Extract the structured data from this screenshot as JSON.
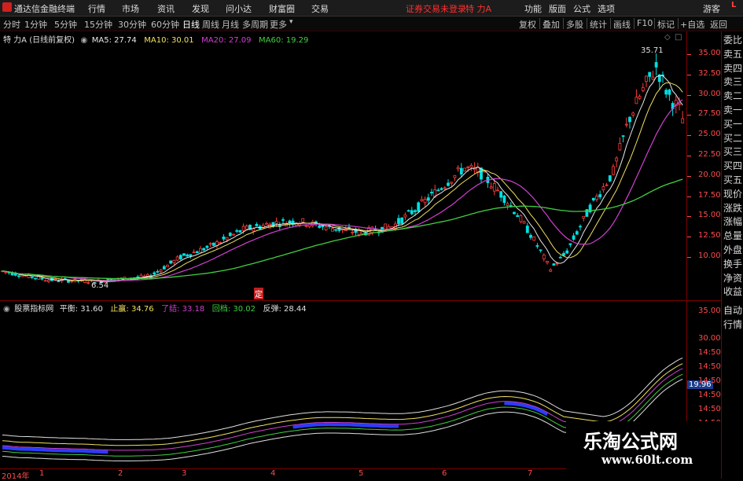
{
  "menubar": {
    "app_title": "通达信金融终端",
    "items": [
      "行情",
      "市场",
      "资讯",
      "发现",
      "问小达",
      "财富圈",
      "交易"
    ],
    "notice": "证券交易未登录",
    "stock_name": "特 力A",
    "right_items": [
      "功能",
      "版面",
      "公式",
      "选项"
    ],
    "user": "游客",
    "corner": "L"
  },
  "periodbar": {
    "periods": [
      "分时",
      "1分钟",
      "5分钟",
      "15分钟",
      "30分钟",
      "60分钟",
      "日线",
      "周线",
      "月线",
      "多周期",
      "更多"
    ],
    "active": "日线",
    "tools": [
      "复权",
      "叠加",
      "多股",
      "统计",
      "画线",
      "F10",
      "标记",
      "+自选",
      "返回"
    ]
  },
  "main": {
    "title": "特 力A (日线前复权)",
    "ma": [
      {
        "label": "MA5: 27.74",
        "color": "#e8e8e8"
      },
      {
        "label": "MA10: 30.01",
        "color": "#f0e060"
      },
      {
        "label": "MA20: 27.09",
        "color": "#d040d0"
      },
      {
        "label": "MA60: 19.29",
        "color": "#40d040"
      }
    ],
    "high_label": "35.71",
    "low_label": "6.54",
    "marker": "定",
    "price_ticks": [
      "35.00",
      "32.50",
      "30.00",
      "27.50",
      "25.00",
      "22.50",
      "20.00",
      "17.50",
      "15.00",
      "12.50",
      "10.00"
    ]
  },
  "indicator": {
    "name": "股票指标网",
    "items": [
      {
        "label": "平衡: 31.60",
        "color": "#e0e0e0"
      },
      {
        "label": "止赢: 34.76",
        "color": "#f0e060"
      },
      {
        "label": "了结: 33.18",
        "color": "#d040d0"
      },
      {
        "label": "回档: 30.02",
        "color": "#40d040"
      },
      {
        "label": "反弹: 28.44",
        "color": "#e0e0e0"
      }
    ],
    "ticks": [
      "35.00",
      "30.00",
      "14:50",
      "14:50",
      "14:50",
      "14:50",
      "14:50",
      "14:50",
      "14:50"
    ],
    "current": "19.96"
  },
  "side": {
    "top_items": [
      "委比",
      "卖五",
      "卖四",
      "卖三",
      "卖二",
      "卖一",
      "买一",
      "买二",
      "买三",
      "买四",
      "买五",
      "现价",
      "涨跌",
      "涨幅",
      "总量",
      "外盘",
      "换手",
      "净资",
      "收益"
    ],
    "bottom_items": [
      "自动",
      "行情"
    ]
  },
  "timeaxis": [
    "2014年",
    "1",
    "2",
    "3",
    "4",
    "5",
    "6",
    "7"
  ],
  "watermark": {
    "title": "乐淘公式网",
    "url": "www.60lt.com"
  },
  "colors": {
    "up": "#ff3c3c",
    "down": "#00e0e0",
    "ma5": "#e8e8e8",
    "ma10": "#f0e060",
    "ma20": "#d040d0",
    "ma60": "#40d040",
    "axis": "#ff4a4a"
  }
}
